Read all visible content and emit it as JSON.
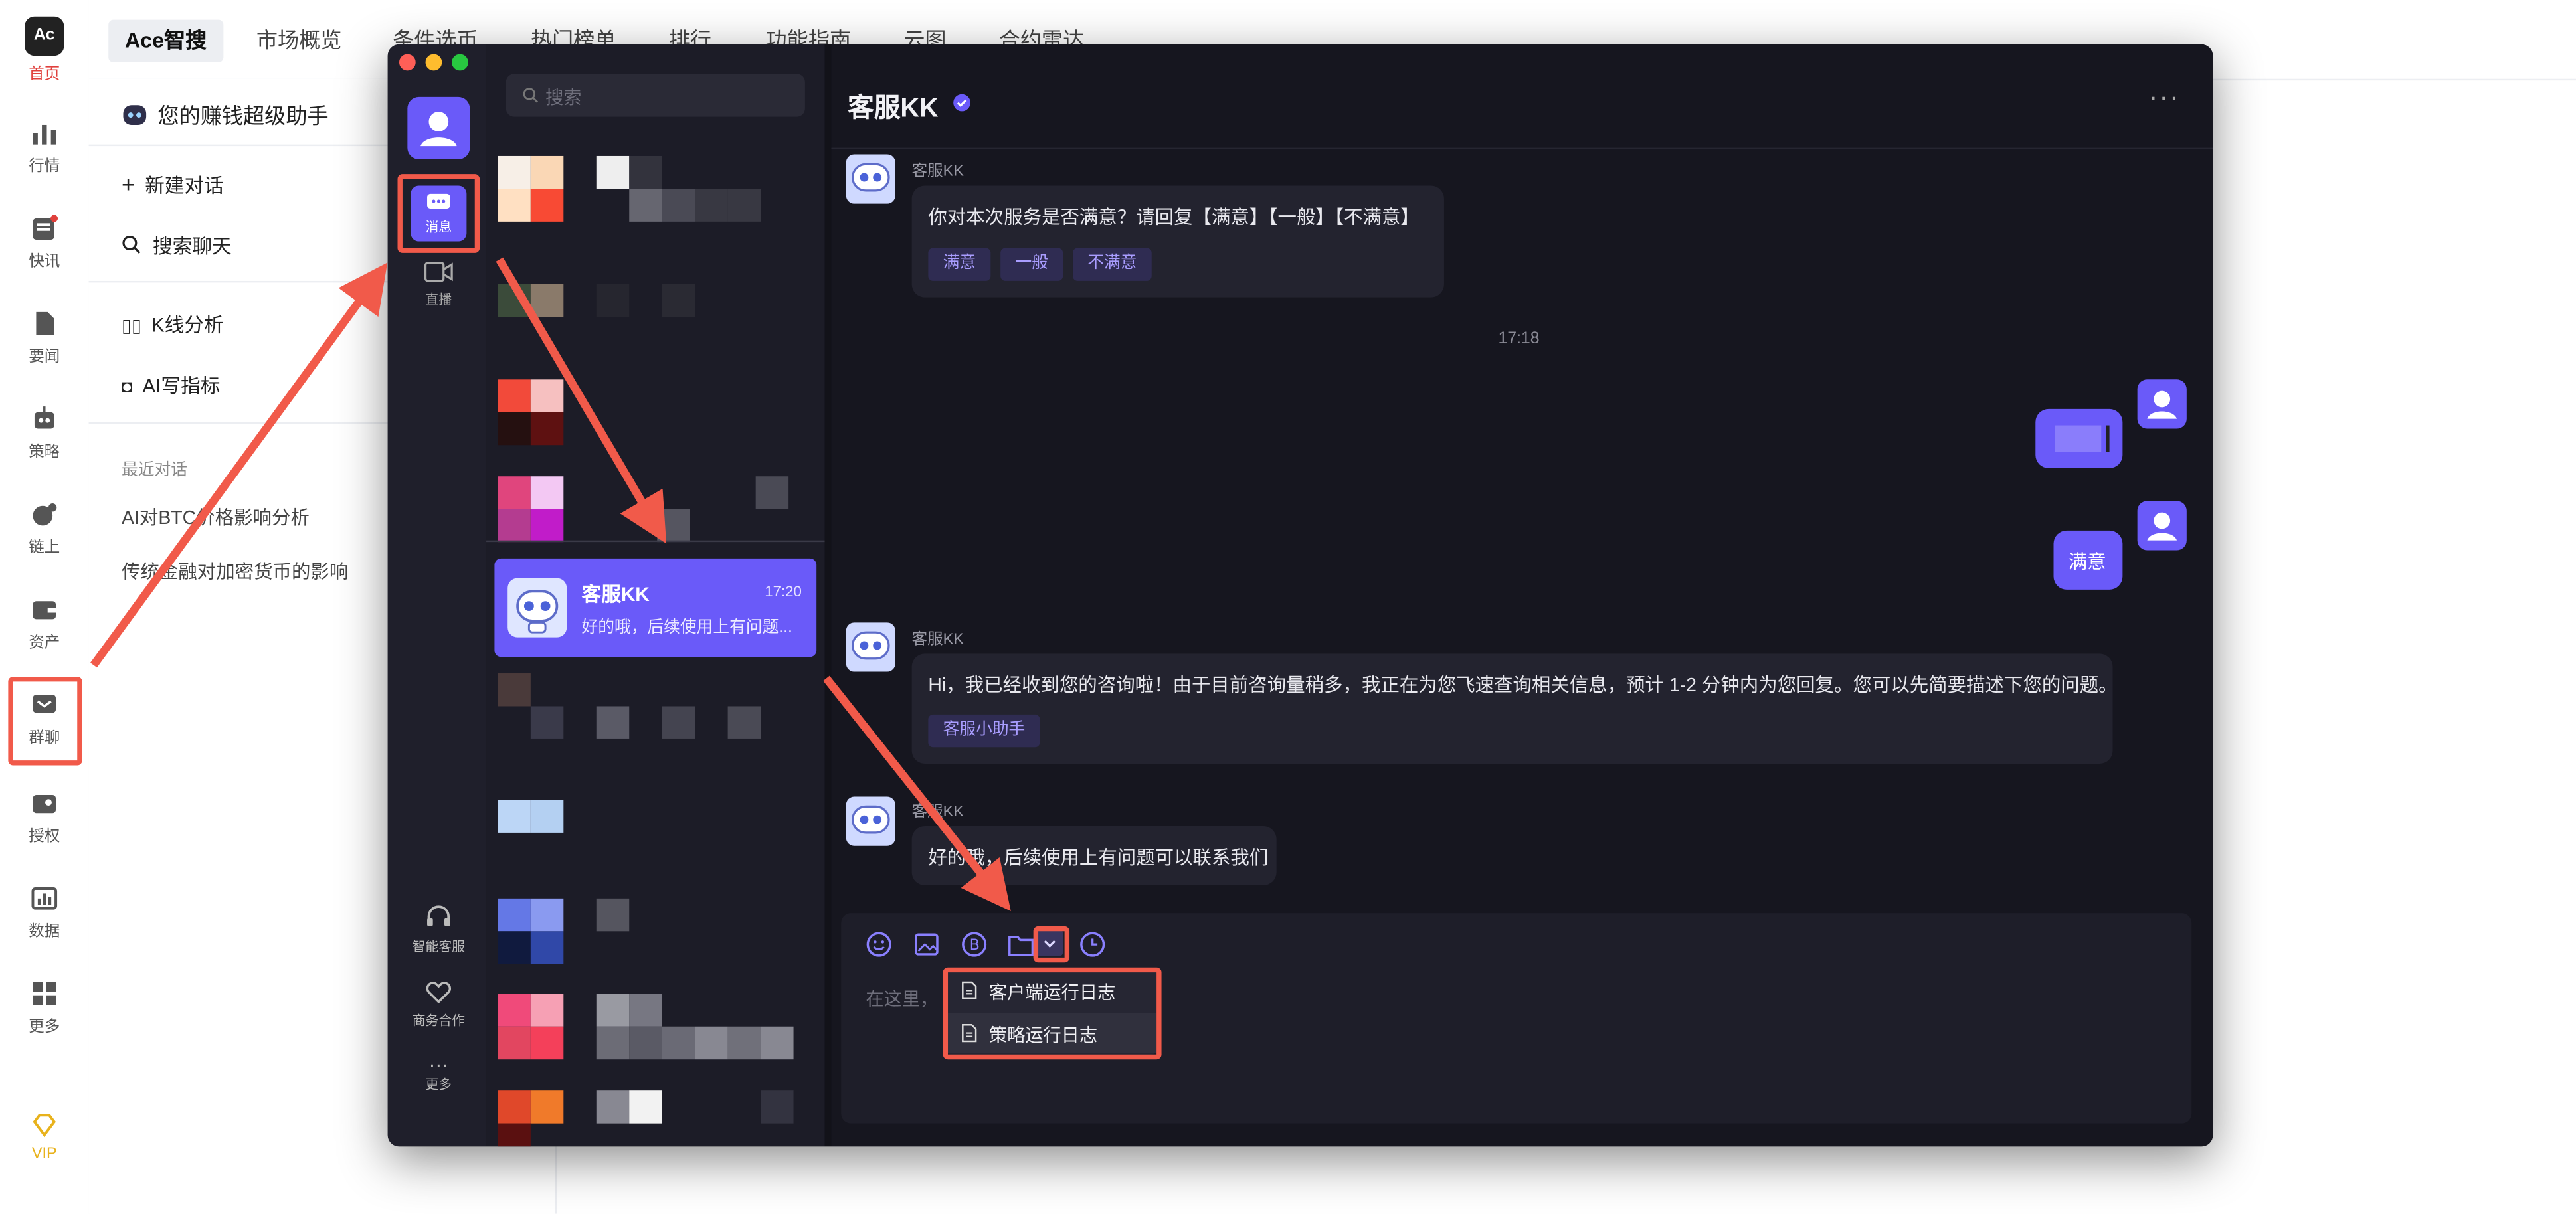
{
  "rail": {
    "items": [
      {
        "label": "首页",
        "icon": "home-logo-icon"
      },
      {
        "label": "行情",
        "icon": "bar-chart-icon"
      },
      {
        "label": "快讯",
        "icon": "news-icon"
      },
      {
        "label": "要闻",
        "icon": "document-icon"
      },
      {
        "label": "策略",
        "icon": "robot-icon"
      },
      {
        "label": "链上",
        "icon": "chain-icon"
      },
      {
        "label": "资产",
        "icon": "wallet-icon"
      },
      {
        "label": "群聊",
        "icon": "group-chat-icon"
      },
      {
        "label": "授权",
        "icon": "auth-icon"
      },
      {
        "label": "数据",
        "icon": "data-icon"
      },
      {
        "label": "更多",
        "icon": "grid-icon"
      },
      {
        "label": "VIP",
        "icon": "diamond-icon"
      }
    ]
  },
  "top_tabs": [
    "Ace智搜",
    "市场概览",
    "条件选币",
    "热门榜单",
    "排行",
    "功能指南",
    "云图",
    "合约雷达"
  ],
  "ai_panel": {
    "title": "您的赚钱超级助手",
    "new_chat": "新建对话",
    "search_chat": "搜索聊天",
    "kline": "K线分析",
    "ai_indicator": "AI写指标",
    "recent_label": "最近对话",
    "recent": [
      "AI对BTC价格影响分析",
      "传统金融对加密货币的影响"
    ]
  },
  "chat_app": {
    "search_placeholder": "搜索",
    "nav": {
      "messages": "消息",
      "live": "直播",
      "support": "智能客服",
      "business": "商务合作",
      "more": "更多"
    },
    "selected_conversation": {
      "name": "客服KK",
      "time": "17:20",
      "preview": "好的哦，后续使用上有问题..."
    },
    "header_title": "客服KK",
    "messages": [
      {
        "sender": "客服KK",
        "text": "你对本次服务是否满意？请回复【满意】【一般】【不满意】",
        "chips": [
          "满意",
          "一般",
          "不满意"
        ]
      },
      {
        "time": "17:18"
      },
      {
        "sender": "me",
        "text": "满意"
      },
      {
        "sender": "客服KK",
        "text": "Hi，我已经收到您的咨询啦！由于目前咨询量稍多，我正在为您飞速查询相关信息，预计 1-2 分钟内为您回复。您可以先简要描述下您的问题。",
        "chips": [
          "客服小助手"
        ]
      },
      {
        "sender": "客服KK",
        "text": "好的哦，后续使用上有问题可以联系我们"
      }
    ],
    "input_placeholder": "在这里，",
    "dropdown": [
      "客户端运行日志",
      "策略运行日志"
    ]
  },
  "colors": {
    "accent": "#6a5af9",
    "annotation": "#f15a4a",
    "window_bg": "#16161f",
    "vip": "#e8b21c"
  }
}
